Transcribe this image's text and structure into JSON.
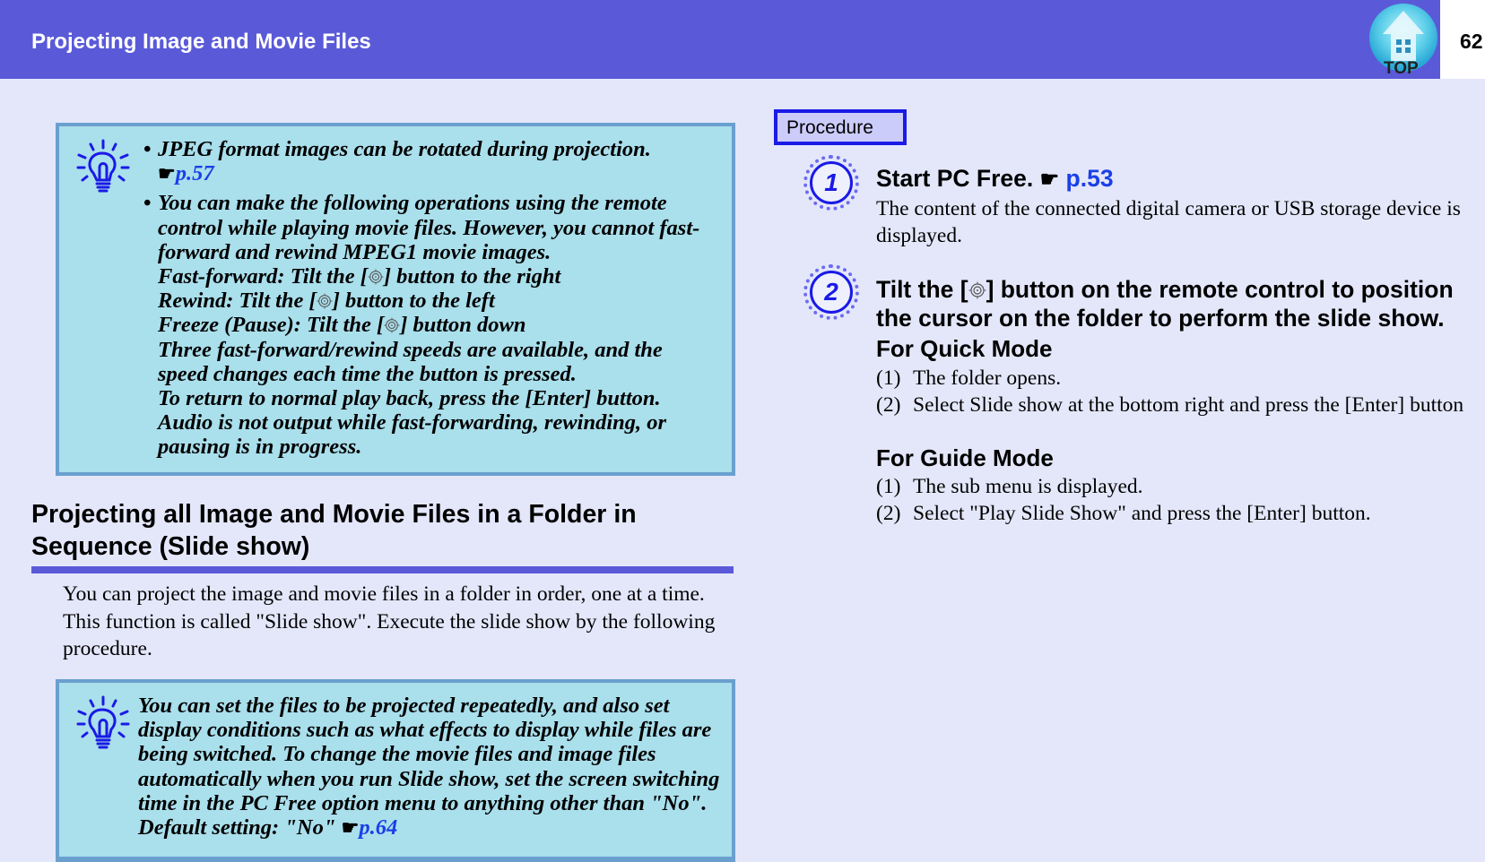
{
  "header": {
    "title": "Projecting Image and Movie Files",
    "page_number": "62",
    "top_button_label": "TOP",
    "colors": {
      "bar": "#5a5ad8",
      "link": "#1a3fe8",
      "note_bg": "#aadfec",
      "note_border": "#6aa0cf"
    }
  },
  "note1": {
    "icon": "lightbulb-icon",
    "bullets": [
      {
        "lines": [
          "JPEG format images can be rotated during projection."
        ],
        "ref_icon": "hand-pointer-icon",
        "ref": "p.57"
      },
      {
        "lines": [
          "You can make the following operations using the remote control while playing movie files. However, you cannot fast-forward and rewind MPEG1 movie images.",
          "Fast-forward: Tilt the [",
          "] button to the right",
          "Rewind: Tilt the [",
          "] button to the left",
          "Freeze (Pause): Tilt the [",
          "] button down",
          "Three fast-forward/rewind speeds are available, and the speed changes each time the button is pressed.",
          "To return to normal play back, press the [Enter] button.",
          "Audio is not output while fast-forwarding, rewinding, or pausing is in progress."
        ]
      }
    ]
  },
  "section": {
    "title": "Projecting all Image and Movie Files in a Folder in Sequence (Slide show)",
    "intro": "You can project the image and movie files in a folder in order, one at a time. This function is called \"Slide show\". Execute the slide show by the following procedure."
  },
  "note2": {
    "icon": "lightbulb-icon",
    "text": "You can set the files to be projected repeatedly, and also set display conditions such as what effects to display while files are being switched. To change the movie files and image files automatically when you run Slide show, set the screen switching time in the PC Free option menu to anything other than \"No\". Default setting: \"No\"",
    "ref_icon": "hand-pointer-icon",
    "ref": "p.64"
  },
  "procedure": {
    "label": "Procedure",
    "steps": [
      {
        "number": "1",
        "title": "Start PC Free.",
        "ref": "p.53",
        "body": "The content of the connected digital camera or USB storage device is displayed."
      },
      {
        "number": "2",
        "title_before": "Tilt the [",
        "title_after": "] button on the remote control to position the cursor on the folder to perform the slide show.",
        "modes": [
          {
            "heading": "For Quick Mode",
            "items": [
              {
                "num": "(1)",
                "text": "The folder opens."
              },
              {
                "num": "(2)",
                "text": "Select Slide show at the bottom right and press the [Enter] button"
              }
            ]
          },
          {
            "heading": "For Guide Mode",
            "items": [
              {
                "num": "(1)",
                "text": "The sub menu is displayed."
              },
              {
                "num": "(2)",
                "text": "Select \"Play Slide Show\" and press the [Enter] button."
              }
            ]
          }
        ]
      }
    ]
  }
}
